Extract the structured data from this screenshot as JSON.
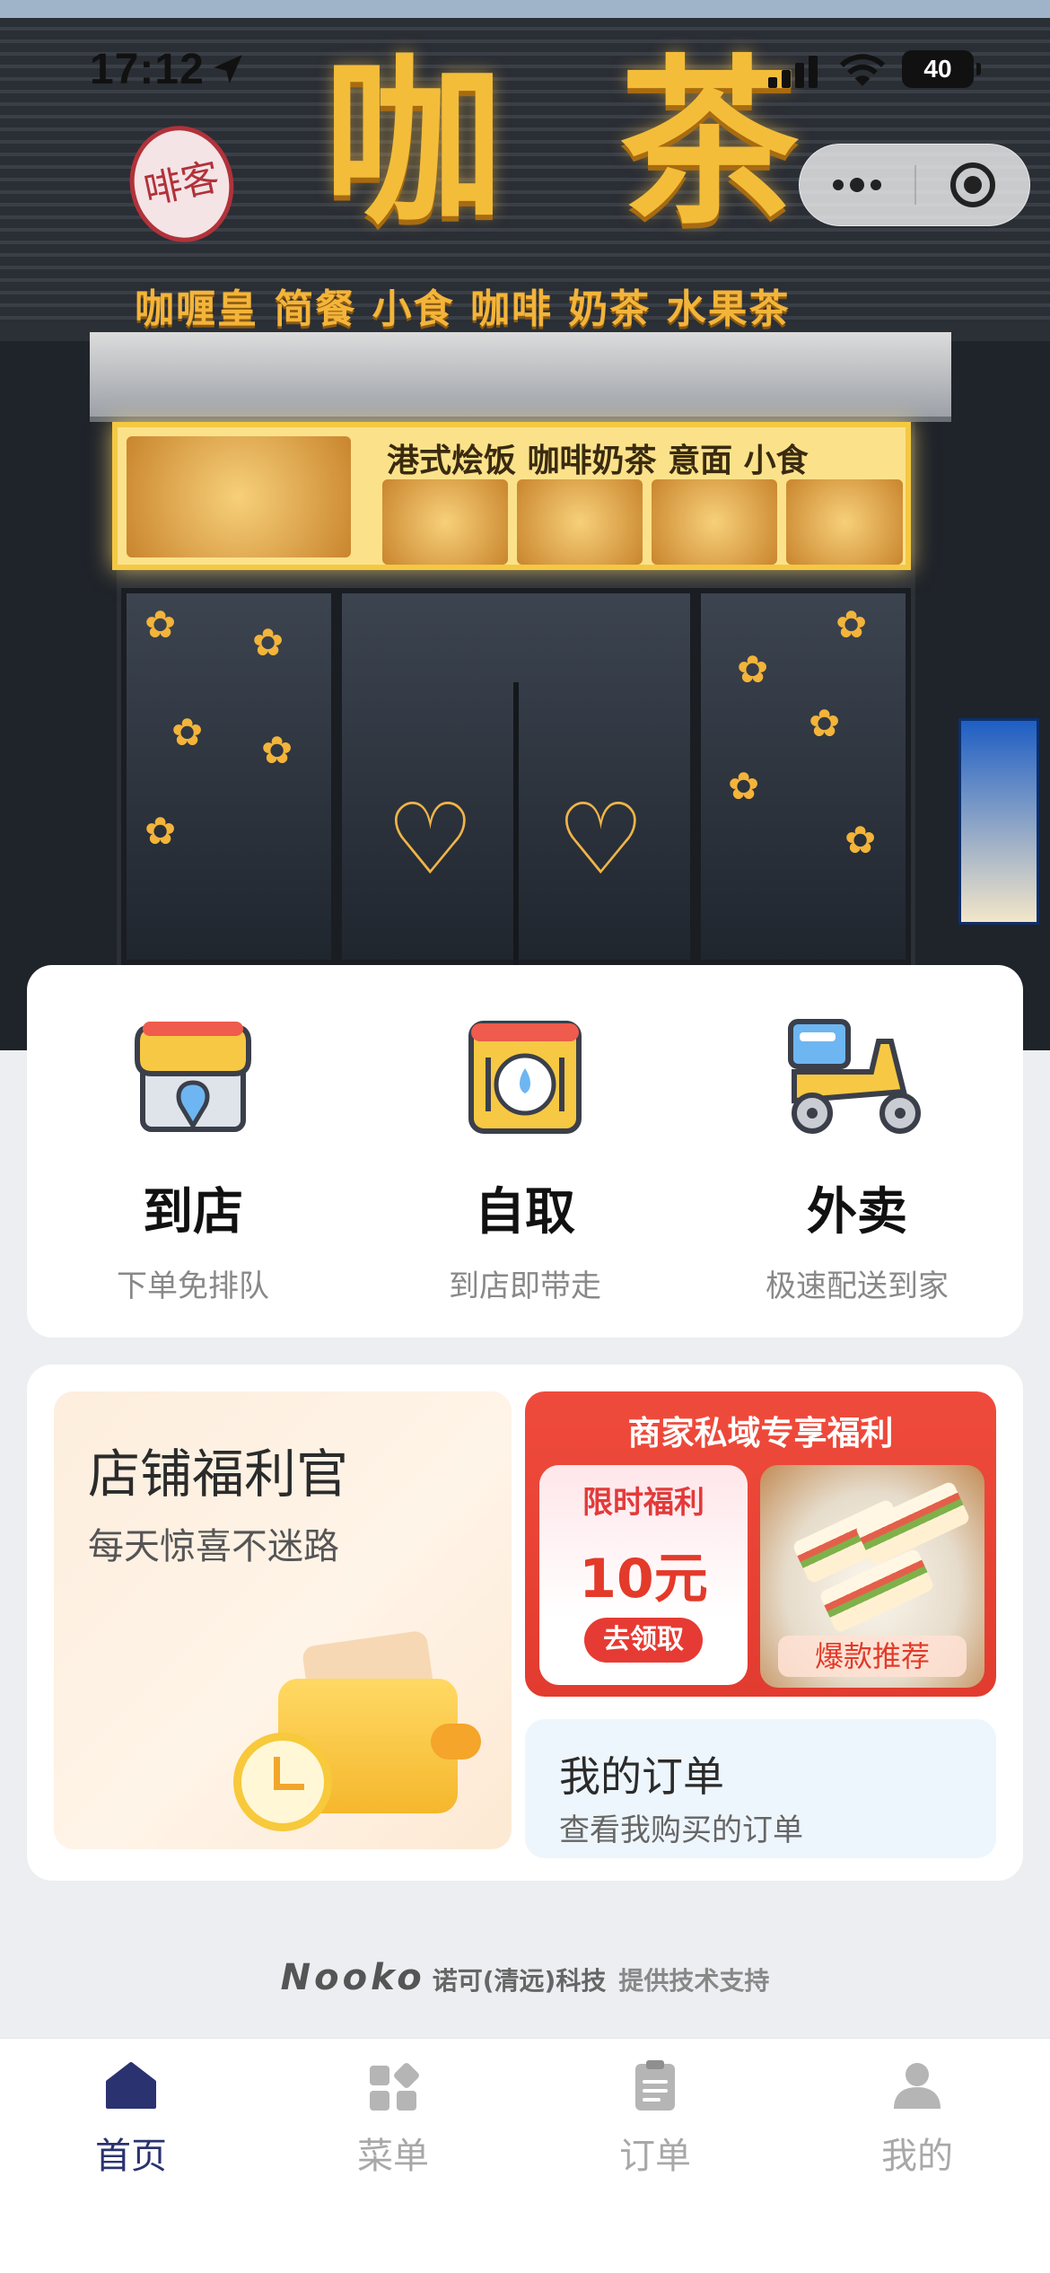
{
  "status_bar": {
    "time": "17:12",
    "battery": "40"
  },
  "storefront": {
    "logo_text": "啡客",
    "sign_char_1": "咖",
    "sign_char_2": "茶",
    "tagline": "咖喱皇 简餐 小食 咖啡 奶茶 水果茶",
    "menu_board_title": "港式烩饭 咖啡奶茶 意面 小食"
  },
  "services": [
    {
      "title": "到店",
      "subtitle": "下单免排队"
    },
    {
      "title": "自取",
      "subtitle": "到店即带走"
    },
    {
      "title": "外卖",
      "subtitle": "极速配送到家"
    }
  ],
  "promo": {
    "welfare_title": "店铺福利官",
    "welfare_subtitle": "每天惊喜不迷路",
    "deal_title": "商家私域专享福利",
    "coupon_title": "限时福利",
    "coupon_amount": "10元",
    "coupon_claim": "去领取",
    "food_tag": "爆款推荐",
    "orders_title": "我的订单",
    "orders_subtitle": "查看我购买的订单"
  },
  "credit": {
    "brand": "Nooko",
    "company": "诺可(清远)科技",
    "support": "提供技术支持"
  },
  "tabbar": {
    "active_color": "#2a3270",
    "inactive_color": "#a8a8a8",
    "tabs": [
      {
        "label": "首页",
        "icon": "home-icon"
      },
      {
        "label": "菜单",
        "icon": "menu-grid-icon"
      },
      {
        "label": "订单",
        "icon": "clipboard-icon"
      },
      {
        "label": "我的",
        "icon": "user-icon"
      }
    ]
  }
}
